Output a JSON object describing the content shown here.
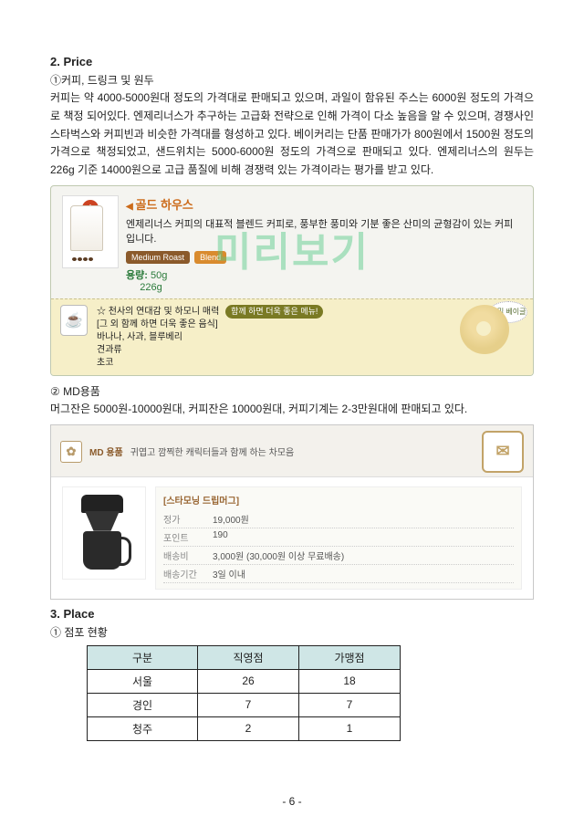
{
  "watermark": "미리보기",
  "section_price": {
    "heading": "2. Price",
    "sub1": "①커피, 드링크 및 원두",
    "para": "커피는 약 4000-5000원대 정도의 가격대로 판매되고 있으며, 과일이 함유된 주스는 6000원 정도의 가격으로 책정 되어있다. 엔제리너스가 추구하는 고급화 전략으로 인해 가격이 다소 높음을 알 수 있으며, 경쟁사인 스타벅스와 커피빈과 비슷한 가격대를 형성하고 있다. 베이커리는 단품 판매가가 800원에서 1500원 정도의 가격으로 책정되었고, 샌드위치는 5000-6000원 정도의 가격으로 판매되고 있다. 엔제리너스의 원두는 226g 기준 14000원으로 고급 품질에 비해 경쟁력 있는 가격이라는 평가를 받고 있다."
  },
  "product1": {
    "title": "골드 하우스",
    "desc": "엔제리너스 커피의 대표적 블렌드 커피로, 풍부한 풍미와 기분 좋은 산미의 균형감이 있는 커피입니다.",
    "badge1": "Medium Roast",
    "badge2": "Blend",
    "weight_label": "용량:",
    "weight1": "50g",
    "weight2": "226g",
    "pair_lead": "☆ 천사의 연대감 및 하모니 매력",
    "pair_pill": "함께 하면 더욱 좋은 메뉴!",
    "pair_items_label": "[그 외 함께 하면 더욱 좋은 음식]",
    "pair_items": "바나나, 사과, 블루베리",
    "pair_items2": "견과류",
    "pair_items3": "초코",
    "bagel_label": "호밀 베이글"
  },
  "section_md": {
    "sub": "② MD용품",
    "para": "머그잔은 5000원-10000원대, 커피잔은 10000원대, 커피기계는 2-3만원대에 판매되고 있다."
  },
  "product2": {
    "hdr_badge": "MD 용품",
    "hdr_tag": "귀엽고 깜찍한 캐릭터들과 함께 하는 차모음",
    "spec_title": "[스타모닝 드립머그]",
    "rows": [
      {
        "k": "정가",
        "v": "19,000원"
      },
      {
        "k": "포인트",
        "v": "190"
      },
      {
        "k": "배송비",
        "v": "3,000원 (30,000원 이상 무료배송)"
      },
      {
        "k": "배송기간",
        "v": "3일 이내"
      }
    ]
  },
  "section_place": {
    "heading": "3. Place",
    "sub": "① 점포 현황"
  },
  "chart_data": {
    "type": "table",
    "title": "점포 현황",
    "columns": [
      "구분",
      "직영점",
      "가맹점"
    ],
    "rows": [
      {
        "구분": "서울",
        "직영점": 26,
        "가맹점": 18
      },
      {
        "구분": "경인",
        "직영점": 7,
        "가맹점": 7
      },
      {
        "구분": "청주",
        "직영점": 2,
        "가맹점": 1
      }
    ]
  },
  "page_number": "- 6 -"
}
